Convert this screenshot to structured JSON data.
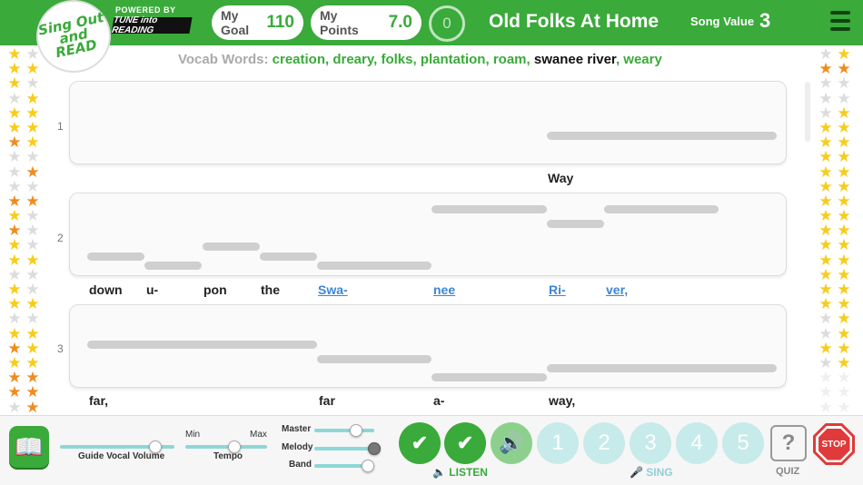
{
  "header": {
    "logo_text": "Sing Out and READ",
    "powered_by": "POWERED BY",
    "tune_logo": "TUNE into READING",
    "goal_label": "My Goal",
    "goal_value": "110",
    "points_label": "My Points",
    "points_value": "7.0",
    "counter": "0",
    "song_title": "Old Folks At Home",
    "song_value_label": "Song Value",
    "song_value": "3"
  },
  "vocab": {
    "label": "Vocab Words:",
    "words": [
      "creation",
      "dreary",
      "folks",
      "plantation",
      "roam",
      "swanee river",
      "weary"
    ],
    "highlighted": "swanee river"
  },
  "rows": [
    {
      "number": "1",
      "lyrics": [
        {
          "text": "Way",
          "link": false
        }
      ]
    },
    {
      "number": "2",
      "lyrics": [
        {
          "text": "down",
          "link": false
        },
        {
          "text": "u-",
          "link": false
        },
        {
          "text": "pon",
          "link": false
        },
        {
          "text": "the",
          "link": false
        },
        {
          "text": "Swa-",
          "link": true
        },
        {
          "text": "nee",
          "link": true
        },
        {
          "text": "Ri-",
          "link": true
        },
        {
          "text": "ver,",
          "link": true
        }
      ]
    },
    {
      "number": "3",
      "lyrics": [
        {
          "text": "far,",
          "link": false
        },
        {
          "text": "far",
          "link": false
        },
        {
          "text": "a-",
          "link": false
        },
        {
          "text": "way,",
          "link": false
        }
      ]
    }
  ],
  "controls": {
    "guide_vocal_label": "Guide Vocal Volume",
    "tempo_min": "Min",
    "tempo_max": "Max",
    "tempo_label": "Tempo",
    "master_label": "Master",
    "melody_label": "Melody",
    "band_label": "Band",
    "listen_label": "LISTEN",
    "sing_label": "SING",
    "sing_buttons": [
      "1",
      "2",
      "3",
      "4",
      "5"
    ],
    "quiz_label": "QUIZ",
    "quiz_icon": "?",
    "stop_label": "STOP",
    "book_icon": "book-icon",
    "guide_vocal_level": 0.83,
    "tempo_level": 0.6,
    "master_level": 0.7,
    "melody_level": 1.0,
    "band_level": 0.9
  },
  "colors": {
    "brand_green": "#3aaa3a",
    "link_blue": "#3a86d8",
    "star_yellow": "#f7cc1c",
    "star_orange": "#f08c1e",
    "star_grey": "#dcdcdc",
    "teal": "#c7eaea",
    "stop_red": "#e03a3a"
  },
  "stars": {
    "left": [
      "y",
      "g",
      "y",
      "y",
      "y",
      "g",
      "g",
      "y",
      "y",
      "y",
      "y",
      "y",
      "o",
      "y",
      "g",
      "g",
      "g",
      "o",
      "g",
      "g",
      "o",
      "o",
      "y",
      "g",
      "o",
      "g",
      "y",
      "g",
      "y",
      "y",
      "g",
      "g",
      "y",
      "g",
      "y",
      "y",
      "g",
      "g",
      "y",
      "y",
      "o",
      "y",
      "y",
      "y",
      "o",
      "o",
      "o",
      "o",
      "g",
      "o"
    ],
    "right": [
      "g",
      "y",
      "o",
      "o",
      "g",
      "g",
      "g",
      "g",
      "g",
      "y",
      "y",
      "y",
      "y",
      "y",
      "y",
      "y",
      "y",
      "y",
      "y",
      "y",
      "y",
      "y",
      "y",
      "y",
      "y",
      "y",
      "y",
      "y",
      "y",
      "y",
      "y",
      "y",
      "y",
      "y",
      "y",
      "y",
      "g",
      "y",
      "g",
      "y",
      "y",
      "y",
      "g",
      "y",
      "e",
      "e",
      "e",
      "e",
      "e",
      "e"
    ]
  }
}
